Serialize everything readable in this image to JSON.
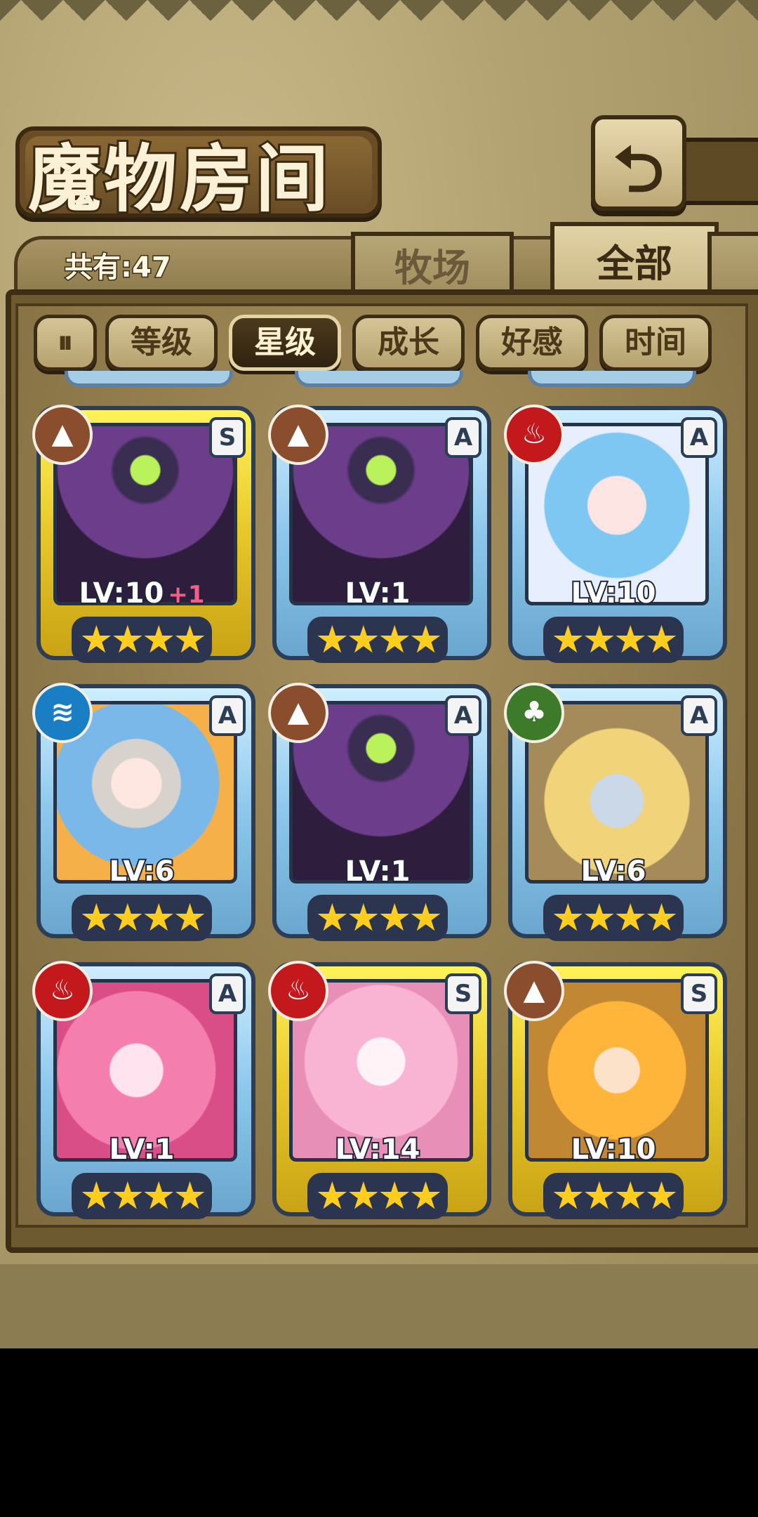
{
  "header": {
    "title": "魔物房间",
    "back_icon": "⮌"
  },
  "info": {
    "count_label": "共有:47"
  },
  "tabs": [
    {
      "label": "牧场"
    },
    {
      "label": "全部"
    }
  ],
  "sort": [
    {
      "label": "等级"
    },
    {
      "label": "星级"
    },
    {
      "label": "成长"
    },
    {
      "label": "好感"
    },
    {
      "label": "时间"
    }
  ],
  "cards": [
    {
      "level": "LV:10",
      "bonus": "+1",
      "rank": "S",
      "element": "earth",
      "stars": "★★★★"
    },
    {
      "level": "LV:1",
      "bonus": "",
      "rank": "A",
      "element": "earth",
      "stars": "★★★★"
    },
    {
      "level": "LV:10",
      "bonus": "",
      "rank": "A",
      "element": "fire",
      "stars": "★★★★"
    },
    {
      "level": "LV:6",
      "bonus": "",
      "rank": "A",
      "element": "water",
      "stars": "★★★★"
    },
    {
      "level": "LV:1",
      "bonus": "",
      "rank": "A",
      "element": "earth",
      "stars": "★★★★"
    },
    {
      "level": "LV:6",
      "bonus": "",
      "rank": "A",
      "element": "wood",
      "stars": "★★★★"
    },
    {
      "level": "LV:1",
      "bonus": "",
      "rank": "A",
      "element": "fire",
      "stars": "★★★★"
    },
    {
      "level": "LV:14",
      "bonus": "",
      "rank": "S",
      "element": "fire",
      "stars": "★★★★"
    },
    {
      "level": "LV:10",
      "bonus": "",
      "rank": "S",
      "element": "earth",
      "stars": "★★★★"
    }
  ],
  "colors": {
    "frame": "#6e5a31",
    "rank_s": "#f3d53a",
    "rank_a": "#8dc7ec",
    "star": "#ffcd1e"
  }
}
